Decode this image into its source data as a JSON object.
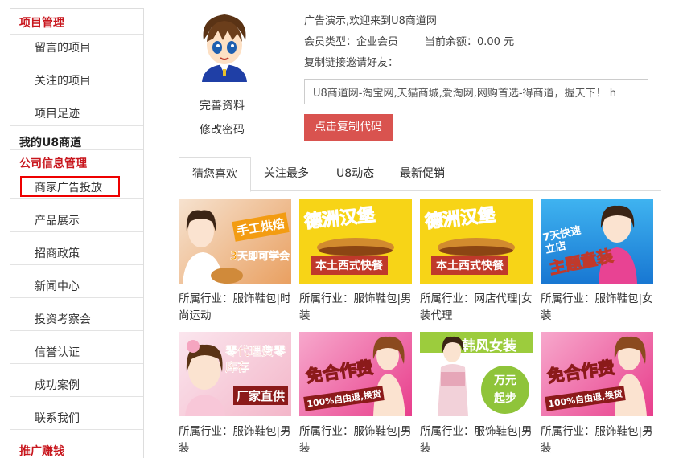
{
  "sidebar": {
    "sections": [
      {
        "title": "项目管理",
        "items": [
          "留言的项目",
          "关注的项目",
          "项目足迹"
        ]
      },
      {
        "title": "我的U8商道",
        "items": []
      },
      {
        "title": "公司信息管理",
        "items": [
          "商家广告投放",
          "产品展示",
          "招商政策",
          "新闻中心",
          "投资考察会",
          "信誉认证",
          "成功案例",
          "联系我们"
        ]
      },
      {
        "title": "推广赚钱",
        "items": []
      }
    ]
  },
  "profile": {
    "complete_label": "完善资料",
    "password_label": "修改密码",
    "welcome": "广告演示,欢迎来到U8商道网",
    "member_type": "会员类型：企业会员",
    "balance": "当前余额：0.00 元",
    "invite_label": "复制链接邀请好友：",
    "invite_text": "U8商道网-淘宝网,天猫商城,爱淘网,网购首选-得商道，握天下！ h",
    "copy_button": "点击复制代码"
  },
  "tabs": [
    "猜您喜欢",
    "关注最多",
    "U8动态",
    "最新促销"
  ],
  "products": [
    {
      "banner": "手工烘焙",
      "banner2": "3天即可学会",
      "caption": "所属行业：服饰鞋包|时尚运动"
    },
    {
      "banner": "德洲汉堡",
      "banner2": "本土西式快餐",
      "caption": "所属行业：服饰鞋包|男装"
    },
    {
      "banner": "德洲汉堡",
      "banner2": "本土西式快餐",
      "caption": "所属行业：网店代理|女装代理"
    },
    {
      "banner": "7天快速立店",
      "banner2": "主题童装",
      "caption": "所属行业：服饰鞋包|女装"
    },
    {
      "banner": "零代理费零库存",
      "banner2": "厂家直供",
      "caption": "所属行业：服饰鞋包|男装"
    },
    {
      "banner": "免合作费",
      "banner2": "100%自由退,换货",
      "caption": "所属行业：服饰鞋包|男装"
    },
    {
      "banner": "韩风女装",
      "banner2": "万元起步",
      "caption": "所属行业：服饰鞋包|男装"
    },
    {
      "banner": "免合作费",
      "banner2": "100%自由退,换货",
      "caption": "所属行业：服饰鞋包|男装"
    }
  ],
  "colors": {
    "accent": "#c8161d",
    "button": "#d9534f",
    "highlight_box": "#ee0000"
  }
}
